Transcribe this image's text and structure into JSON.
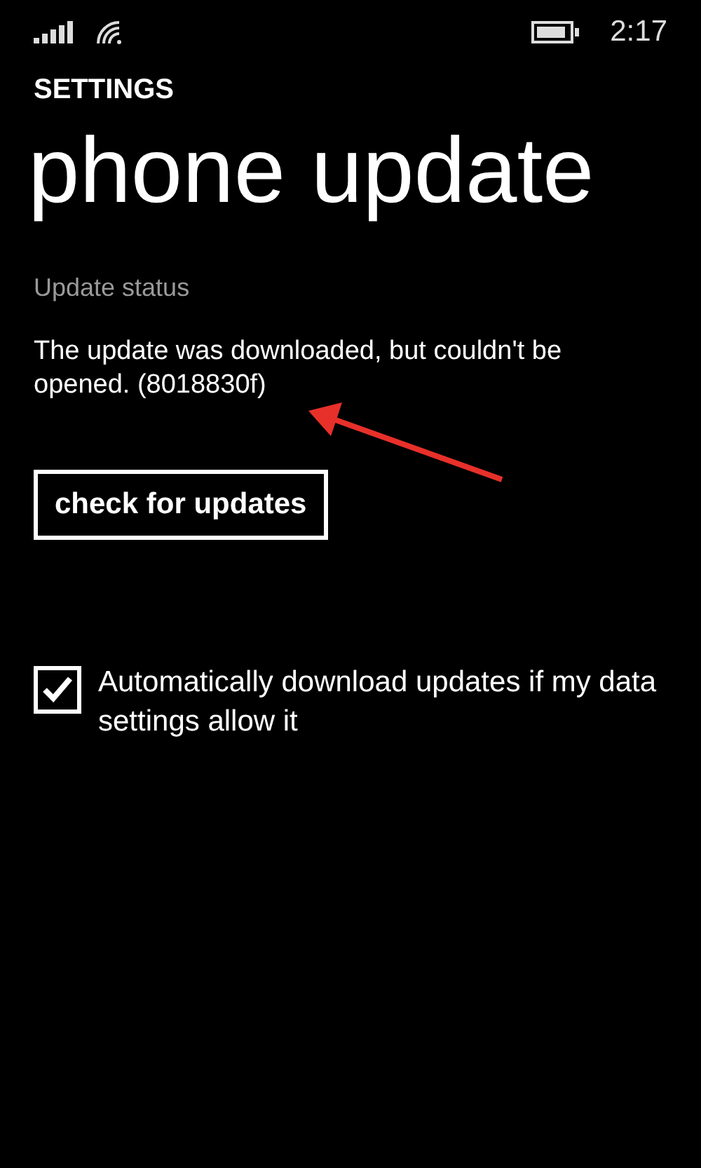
{
  "status_bar": {
    "time": "2:17"
  },
  "header": {
    "app": "SETTINGS",
    "title": "phone update"
  },
  "update_status": {
    "label": "Update status",
    "message": "The update was downloaded, but couldn't be opened. (8018830f)"
  },
  "button": {
    "label": "check for updates"
  },
  "auto_download": {
    "label": "Automatically download updates if my data settings allow it",
    "checked": true
  },
  "annotation": {
    "kind": "arrow"
  }
}
